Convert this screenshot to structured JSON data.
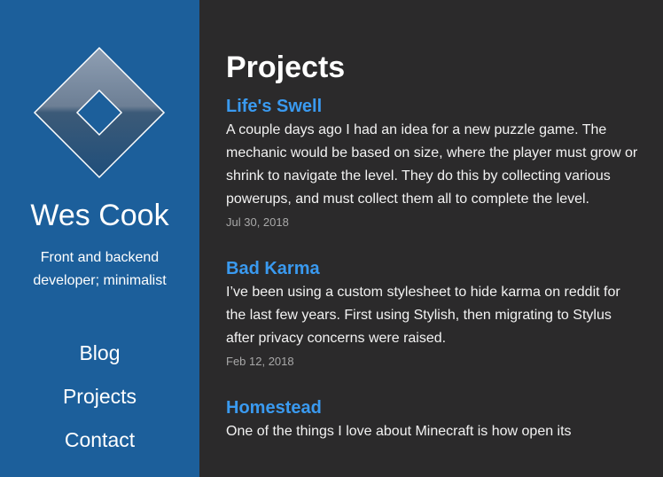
{
  "sidebar": {
    "site_name": "Wes Cook",
    "tagline": "Front and backend developer; minimalist",
    "nav": [
      {
        "label": "Blog"
      },
      {
        "label": "Projects"
      },
      {
        "label": "Contact"
      }
    ],
    "colors": {
      "background": "#1c5f9b",
      "logo_outline": "#ffffff"
    }
  },
  "main": {
    "title": "Projects",
    "posts": [
      {
        "title": "Life's Swell",
        "excerpt": "A couple days ago I had an idea for a new puzzle game. The mechanic would be based on size, where the player must grow or shrink to navigate the level. They do this by collecting various powerups, and must collect them all to complete the level.",
        "date": "Jul 30, 2018"
      },
      {
        "title": "Bad Karma",
        "excerpt": "I’ve been using a custom stylesheet to hide karma on reddit for the last few years. First using Stylish, then migrating to Stylus after privacy concerns were raised.",
        "date": "Feb 12, 2018"
      },
      {
        "title": "Homestead",
        "excerpt": "One of the things I love about Minecraft is how open its",
        "date": ""
      }
    ],
    "colors": {
      "background": "#2b2a2b",
      "link": "#3a9af0",
      "date": "#a8a8a8"
    }
  }
}
